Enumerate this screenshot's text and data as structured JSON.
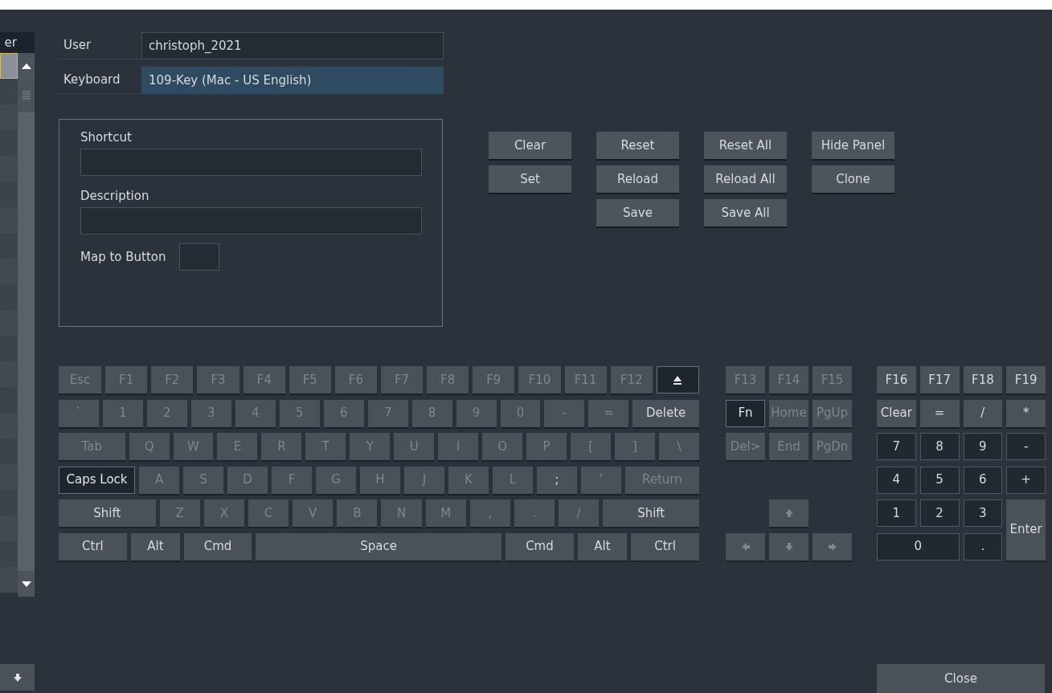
{
  "list": {
    "header": "er",
    "rows": [
      {
        "selected": true
      },
      {
        "selected": false
      },
      {
        "selected": false
      },
      {
        "selected": false
      },
      {
        "selected": false
      },
      {
        "selected": false
      },
      {
        "selected": false
      },
      {
        "selected": false
      },
      {
        "selected": false
      },
      {
        "selected": false
      },
      {
        "selected": false
      },
      {
        "selected": false
      },
      {
        "selected": false
      },
      {
        "selected": false
      },
      {
        "selected": false
      },
      {
        "selected": false
      },
      {
        "selected": false
      },
      {
        "selected": false
      },
      {
        "selected": false
      },
      {
        "selected": false
      },
      {
        "selected": false
      }
    ]
  },
  "user": {
    "label": "User",
    "value": "christoph_2021"
  },
  "keyboard": {
    "label": "Keyboard",
    "value": "109-Key (Mac - US English)",
    "selected": true
  },
  "shortcut_panel": {
    "shortcut_label": "Shortcut",
    "description_label": "Description",
    "map_label": "Map to Button"
  },
  "button_columns": [
    [
      "Clear",
      "Set"
    ],
    [
      "Reset",
      "Reload",
      "Save"
    ],
    [
      "Reset All",
      "Reload All",
      "Save All"
    ],
    [
      "Hide Panel",
      "Clone"
    ]
  ],
  "main_keys": [
    [
      {
        "label": "Esc",
        "kind": "dim"
      },
      {
        "label": "F1",
        "kind": "dim"
      },
      {
        "label": "F2",
        "kind": "dim"
      },
      {
        "label": "F3",
        "kind": "dim"
      },
      {
        "label": "F4",
        "kind": "dim"
      },
      {
        "label": "F5",
        "kind": "dim"
      },
      {
        "label": "F6",
        "kind": "dim"
      },
      {
        "label": "F7",
        "kind": "dim"
      },
      {
        "label": "F8",
        "kind": "dim"
      },
      {
        "label": "F9",
        "kind": "dim"
      },
      {
        "label": "F10",
        "kind": "dim"
      },
      {
        "label": "F11",
        "kind": "dim"
      },
      {
        "label": "F12",
        "kind": "dim"
      },
      {
        "kind": "held"
      }
    ],
    [
      {
        "label": "`",
        "kind": "dim"
      },
      {
        "label": "1",
        "kind": "dim"
      },
      {
        "label": "2",
        "kind": "dim"
      },
      {
        "label": "3",
        "kind": "dim"
      },
      {
        "label": "4",
        "kind": "dim"
      },
      {
        "label": "5",
        "kind": "dim"
      },
      {
        "label": "6",
        "kind": "dim"
      },
      {
        "label": "7",
        "kind": "dim"
      },
      {
        "label": "8",
        "kind": "dim"
      },
      {
        "label": "9",
        "kind": "dim"
      },
      {
        "label": "0",
        "kind": "dim"
      },
      {
        "label": "-",
        "kind": "dim"
      },
      {
        "label": "=",
        "kind": "dim"
      },
      {
        "label": "Delete",
        "kind": "key"
      }
    ],
    [
      {
        "label": "Tab",
        "kind": "dim"
      },
      {
        "label": "Q",
        "kind": "dim"
      },
      {
        "label": "W",
        "kind": "dim"
      },
      {
        "label": "E",
        "kind": "dim"
      },
      {
        "label": "R",
        "kind": "dim"
      },
      {
        "label": "T",
        "kind": "dim"
      },
      {
        "label": "Y",
        "kind": "dim"
      },
      {
        "label": "U",
        "kind": "dim"
      },
      {
        "label": "I",
        "kind": "dim"
      },
      {
        "label": "O",
        "kind": "dim"
      },
      {
        "label": "P",
        "kind": "dim"
      },
      {
        "label": "[",
        "kind": "dim"
      },
      {
        "label": "]",
        "kind": "dim"
      },
      {
        "label": "\\",
        "kind": "dim"
      }
    ],
    [
      {
        "label": "Caps Lock",
        "kind": "held"
      },
      {
        "label": "A",
        "kind": "dim"
      },
      {
        "label": "S",
        "kind": "dim"
      },
      {
        "label": "D",
        "kind": "dim"
      },
      {
        "label": "F",
        "kind": "dim"
      },
      {
        "label": "G",
        "kind": "dim"
      },
      {
        "label": "H",
        "kind": "dim"
      },
      {
        "label": "J",
        "kind": "dim"
      },
      {
        "label": "K",
        "kind": "dim"
      },
      {
        "label": "L",
        "kind": "dim"
      },
      {
        "label": ";",
        "kind": "key"
      },
      {
        "label": "'",
        "kind": "dim"
      },
      {
        "label": "Return",
        "kind": "dim"
      }
    ],
    [
      {
        "label": "Shift",
        "kind": "key"
      },
      {
        "label": "Z",
        "kind": "dim"
      },
      {
        "label": "X",
        "kind": "dim"
      },
      {
        "label": "C",
        "kind": "dim"
      },
      {
        "label": "V",
        "kind": "dim"
      },
      {
        "label": "B",
        "kind": "dim"
      },
      {
        "label": "N",
        "kind": "dim"
      },
      {
        "label": "M",
        "kind": "dim"
      },
      {
        "label": ",",
        "kind": "dim"
      },
      {
        "label": ".",
        "kind": "dim"
      },
      {
        "label": "/",
        "kind": "dim"
      },
      {
        "label": "Shift",
        "kind": "key"
      }
    ],
    [
      {
        "label": "Ctrl",
        "kind": "key"
      },
      {
        "label": "Alt",
        "kind": "key"
      },
      {
        "label": "Cmd",
        "kind": "key"
      },
      {
        "label": "Space",
        "kind": "key"
      },
      {
        "label": "Cmd",
        "kind": "key"
      },
      {
        "label": "Alt",
        "kind": "key"
      },
      {
        "label": "Ctrl",
        "kind": "key"
      }
    ]
  ],
  "nav_keys": [
    {
      "label": "F13",
      "kind": "dim"
    },
    {
      "label": "F14",
      "kind": "dim"
    },
    {
      "label": "F15",
      "kind": "dim"
    },
    {
      "label": "Fn",
      "kind": "held"
    },
    {
      "label": "Home",
      "kind": "dim"
    },
    {
      "label": "PgUp",
      "kind": "dim"
    },
    {
      "label": "Del>",
      "kind": "dim"
    },
    {
      "label": "End",
      "kind": "dim"
    },
    {
      "label": "PgDn",
      "kind": "dim"
    },
    {
      "kind": "dim"
    },
    {
      "kind": "dim"
    },
    {
      "kind": "dim"
    },
    {
      "kind": "dim"
    }
  ],
  "numpad_keys": [
    {
      "label": "F16",
      "kind": "key"
    },
    {
      "label": "F17",
      "kind": "key"
    },
    {
      "label": "F18",
      "kind": "key"
    },
    {
      "label": "F19",
      "kind": "key"
    },
    {
      "label": "Clear",
      "kind": "key"
    },
    {
      "label": "=",
      "kind": "key"
    },
    {
      "label": "/",
      "kind": "key"
    },
    {
      "label": "*",
      "kind": "key"
    },
    {
      "label": "7",
      "kind": "pad"
    },
    {
      "label": "8",
      "kind": "pad"
    },
    {
      "label": "9",
      "kind": "pad"
    },
    {
      "label": "-",
      "kind": "pad"
    },
    {
      "label": "4",
      "kind": "pad"
    },
    {
      "label": "5",
      "kind": "pad"
    },
    {
      "label": "6",
      "kind": "pad"
    },
    {
      "label": "+",
      "kind": "pad"
    },
    {
      "label": "1",
      "kind": "pad"
    },
    {
      "label": "2",
      "kind": "pad"
    },
    {
      "label": "3",
      "kind": "pad"
    },
    {
      "label": "Enter",
      "kind": "key"
    },
    {
      "label": "0",
      "kind": "pad"
    },
    {
      "label": ".",
      "kind": "pad"
    }
  ],
  "close_button": "Close"
}
